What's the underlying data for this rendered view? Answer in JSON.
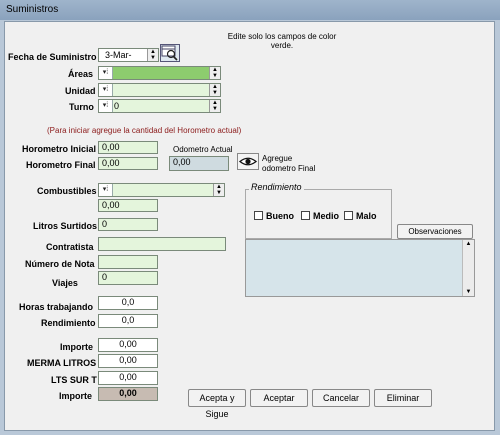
{
  "window": {
    "title": "Suministros"
  },
  "instructions": {
    "line1": "Edite solo los campos de color",
    "line2": "verde."
  },
  "fecha": {
    "label": "Fecha de Suministro",
    "value": "3-Mar-"
  },
  "areas": {
    "label": "Áreas",
    "value": ""
  },
  "unidad": {
    "label": "Unidad",
    "value": ""
  },
  "turno": {
    "label": "Turno",
    "value": "0"
  },
  "note": "(Para iniciar agregue la cantidad del Horometro actual)",
  "horometro_inicial": {
    "label": "Horometro Inicial",
    "value": "0,00"
  },
  "horometro_final": {
    "label": "Horometro Final",
    "value": "0,00"
  },
  "odometro": {
    "label": "Odometro Actual",
    "value": "0,00"
  },
  "agregue": {
    "line1": "Agregue",
    "line2": "odometro Final"
  },
  "combustibles": {
    "label": "Combustibles",
    "value": "",
    "value2": "0,00"
  },
  "rendimiento_group": {
    "title": "Rendimiento",
    "options": [
      "Bueno",
      "Medio",
      "Malo"
    ]
  },
  "observaciones": {
    "label": "Observaciones",
    "value": ""
  },
  "litros_surtidos": {
    "label": "Litros Surtidos",
    "value": "0"
  },
  "contratista": {
    "label": "Contratista",
    "value": ""
  },
  "numero_nota": {
    "label": "Número de Nota",
    "value": ""
  },
  "viajes": {
    "label": "Viajes",
    "value": "0"
  },
  "horas_trabajando": {
    "label": "Horas trabajando",
    "value": "0,0"
  },
  "rendimiento": {
    "label": "Rendimiento",
    "value": "0,0"
  },
  "importe": {
    "label": "Importe",
    "value": "0,00"
  },
  "merma": {
    "label": "MERMA  LITROS",
    "value": "0,00"
  },
  "lts_sur": {
    "label": "LTS SUR T",
    "value": "0,00"
  },
  "importe2": {
    "label": "Importe",
    "value": "0,00"
  },
  "buttons": {
    "acepta_sigue": "Acepta y Sigue",
    "aceptar": "Aceptar",
    "cancelar": "Cancelar",
    "eliminar": "Eliminar"
  },
  "colors": {
    "green_field": "#e4f5dc",
    "gray_field": "#cfdbe0",
    "brown_field": "#c7bbb2",
    "note_red": "#8b1a1a"
  }
}
